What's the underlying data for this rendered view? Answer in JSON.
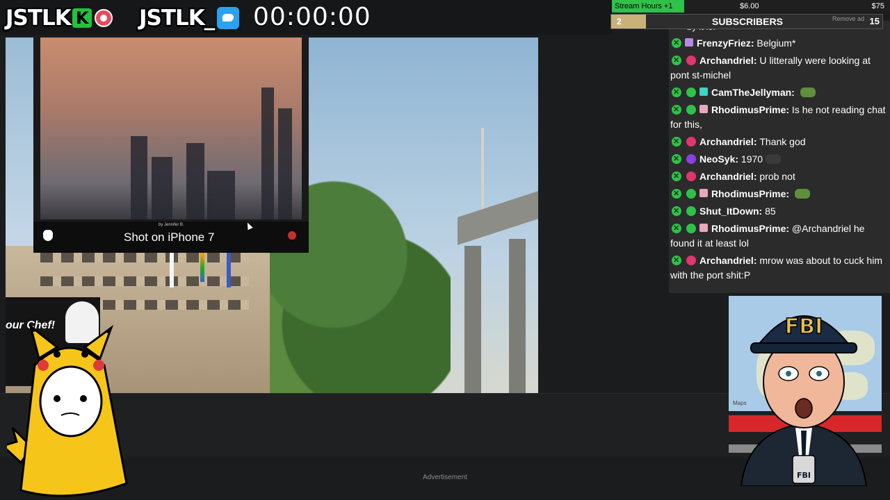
{
  "header": {
    "brand_primary": "JSTLK",
    "brand_k": "K",
    "brand_secondary": "JSTLK_",
    "timer": "00:00:00"
  },
  "video": {
    "caption_credit": "by Jennifer B.",
    "caption_text": "Shot on iPhone 7",
    "poster_text": "our Chef!"
  },
  "stats": {
    "stream_hours": "Stream Hours +1",
    "money": "$6.00",
    "goal": "$75"
  },
  "subscribers": {
    "progress": "2",
    "title": "SUBSCRIBERS",
    "remove": "Remove ad",
    "count": "15"
  },
  "chat": {
    "partial_top": "by it lol",
    "messages": [
      {
        "user": "FrenzyFriez",
        "text": "Belgium*",
        "dot_color": "",
        "gift": true,
        "gift_color": "#b48be0"
      },
      {
        "user": "Archandriel",
        "text": "U litterally were looking at pont st-michel",
        "dot_color": "#e0366e",
        "gift": false,
        "gift_color": ""
      },
      {
        "user": "CamTheJellyman",
        "text": "",
        "dot_color": "#2fc24a",
        "gift": true,
        "gift_color": "#3fd3c9",
        "emote": true
      },
      {
        "user": "RhodimusPrime",
        "text": "Is he not reading chat for this,",
        "dot_color": "#2fc24a",
        "gift": true,
        "gift_color": "#e8a7c0"
      },
      {
        "user": "Archandriel",
        "text": "Thank god",
        "dot_color": "#e0366e",
        "gift": false,
        "gift_color": ""
      },
      {
        "user": "NeoSyk",
        "text": "1970",
        "dot_color": "#8a3fe0",
        "gift": false,
        "gift_color": "",
        "emote": true
      },
      {
        "user": "Archandriel",
        "text": "prob not",
        "dot_color": "#e0366e",
        "gift": false,
        "gift_color": ""
      },
      {
        "user": "RhodimusPrime",
        "text": "",
        "dot_color": "#2fc24a",
        "gift": true,
        "gift_color": "#e8a7c0",
        "emote": true
      },
      {
        "user": "Shut_ItDown",
        "text": "85",
        "dot_color": "#2fc24a",
        "gift": false,
        "gift_color": ""
      },
      {
        "user": "RhodimusPrime",
        "text": "@Archandriel he found it at least lol",
        "dot_color": "#2fc24a",
        "gift": true,
        "gift_color": "#e8a7c0"
      },
      {
        "user": "Archandriel",
        "text": "mrow was about to cuck him with the port shit:P",
        "dot_color": "#e0366e",
        "gift": false,
        "gift_color": ""
      }
    ]
  },
  "webcam": {
    "maps_label": "Maps",
    "badge_text": "FBI"
  },
  "ad": {
    "label": "Advertisement"
  }
}
